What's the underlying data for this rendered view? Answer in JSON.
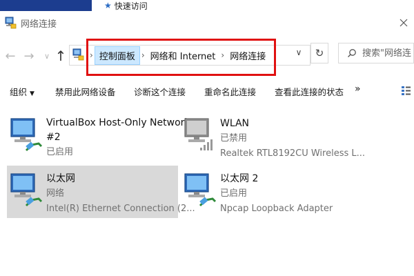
{
  "quick_access_tab": "快速访问",
  "window": {
    "title": "网络连接"
  },
  "breadcrumb": {
    "items": [
      "控制面板",
      "网络和 Internet",
      "网络连接"
    ]
  },
  "search": {
    "placeholder": "搜索\"网络连"
  },
  "commands": {
    "organize": "组织",
    "disable": "禁用此网络设备",
    "diagnose": "诊断这个连接",
    "rename": "重命名此连接",
    "status": "查看此连接的状态",
    "more": "»"
  },
  "connections": [
    {
      "name_line1": "VirtualBox Host-Only Network",
      "name_line2": "#2",
      "status": "已启用",
      "adapter": ""
    },
    {
      "name_line1": "WLAN",
      "status": "已禁用",
      "adapter": "Realtek RTL8192CU Wireless L..."
    },
    {
      "name_line1": "以太网",
      "status": "网络",
      "adapter": "Intel(R) Ethernet Connection (2..."
    },
    {
      "name_line1": "以太网 2",
      "status": "已启用",
      "adapter": "Npcap Loopback Adapter"
    }
  ],
  "colors": {
    "selection": "#d9d9d9",
    "breadcrumb_highlight": "#cce8ff",
    "annotation_red": "#e01010",
    "top_strip_blue": "#1c3d8f"
  },
  "icons": {
    "app": "network-connections-icon",
    "search": "search-icon",
    "refresh": "refresh-icon",
    "up": "up-arrow-icon"
  }
}
